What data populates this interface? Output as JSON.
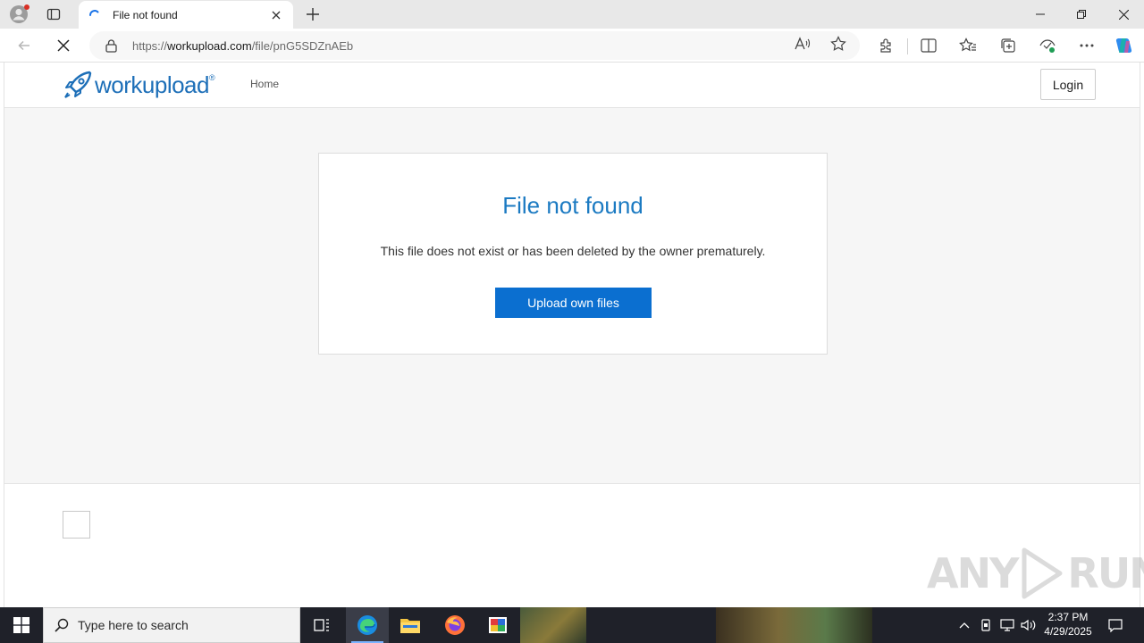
{
  "browser": {
    "tab_title": "File not found",
    "url_prefix": "https://",
    "url_host": "workupload.com",
    "url_path": "/file/pnG5SDZnAEb"
  },
  "site": {
    "logo_text": "workupload",
    "logo_reg": "®",
    "nav_home": "Home",
    "login_label": "Login"
  },
  "card": {
    "title": "File not found",
    "message": "This file does not exist or has been deleted by the owner prematurely.",
    "button_label": "Upload own files"
  },
  "watermark": {
    "left": "ANY",
    "right": "RUN"
  },
  "taskbar": {
    "search_placeholder": "Type here to search",
    "time": "2:37 PM",
    "date": "4/29/2025"
  },
  "colors": {
    "brand_blue": "#1d6fb8",
    "title_blue": "#1b7ac2",
    "button_blue": "#0b6fd0"
  }
}
